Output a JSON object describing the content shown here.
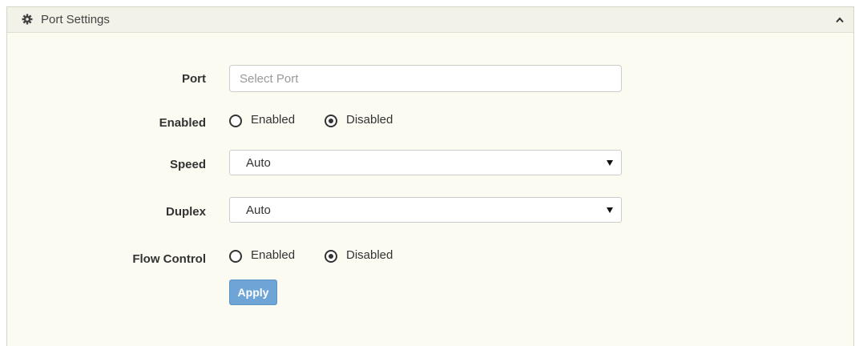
{
  "panel": {
    "title": "Port Settings",
    "icon": "gear-icon",
    "collapse_icon": "chevron-up-icon"
  },
  "form": {
    "port": {
      "label": "Port",
      "placeholder": "Select Port",
      "value": ""
    },
    "enabled": {
      "label": "Enabled",
      "options": [
        "Enabled",
        "Disabled"
      ],
      "selected": "Disabled"
    },
    "speed": {
      "label": "Speed",
      "value": "Auto"
    },
    "duplex": {
      "label": "Duplex",
      "value": "Auto"
    },
    "flow_control": {
      "label": "Flow Control",
      "options": [
        "Enabled",
        "Disabled"
      ],
      "selected": "Disabled"
    },
    "apply_label": "Apply"
  },
  "colors": {
    "panel_bg": "#fbfbf2",
    "header_bg": "#f2f2e9",
    "apply_bg": "#6fa4d6"
  }
}
